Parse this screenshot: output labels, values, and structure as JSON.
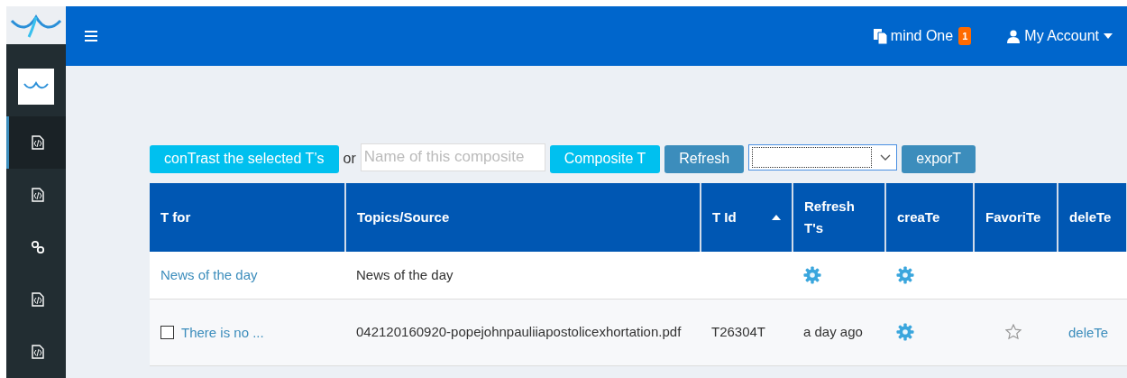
{
  "header": {
    "notifications": {
      "label": "mind One",
      "badge": "1"
    },
    "account": {
      "label": "My Account"
    }
  },
  "sidebar": {
    "items": [
      {
        "kind": "file",
        "selected": true
      },
      {
        "kind": "file",
        "selected": false
      },
      {
        "kind": "link",
        "selected": false
      },
      {
        "kind": "file",
        "selected": false
      },
      {
        "kind": "file",
        "selected": false
      }
    ]
  },
  "toolbar": {
    "contrast_button": "conTrast the selected T’s",
    "or_text": "or",
    "name_field": {
      "placeholder": "Name of this composite"
    },
    "composite_button": "Composite T",
    "refresh_button": "Refresh",
    "export_button": "exporT"
  },
  "table": {
    "columns": [
      {
        "label": "T for",
        "sorted": false
      },
      {
        "label": "Topics/Source",
        "sorted": false
      },
      {
        "label": "T Id",
        "sorted": true
      },
      {
        "label": "Refresh T's",
        "sorted": false
      },
      {
        "label": "creaTe",
        "sorted": false
      },
      {
        "label": "FavoriTe",
        "sorted": false
      },
      {
        "label": "deleTe",
        "sorted": false
      }
    ],
    "rows": [
      {
        "cells": [
          {
            "kind": "link",
            "text": "News of the day"
          },
          {
            "kind": "text",
            "text": "News of the day"
          },
          {
            "kind": "empty"
          },
          {
            "kind": "gear"
          },
          {
            "kind": "gear"
          },
          {
            "kind": "empty"
          },
          {
            "kind": "empty"
          }
        ]
      },
      {
        "cells": [
          {
            "kind": "check-link",
            "checked": false,
            "text": "There is no ..."
          },
          {
            "kind": "text",
            "text": "042120160920-popejohnpauliiapostolicexhortation.pdf"
          },
          {
            "kind": "text",
            "text": "T26304T"
          },
          {
            "kind": "text",
            "text": "a day ago"
          },
          {
            "kind": "gear"
          },
          {
            "kind": "star",
            "on": false
          },
          {
            "kind": "link",
            "text": "deleTe"
          }
        ]
      }
    ]
  }
}
